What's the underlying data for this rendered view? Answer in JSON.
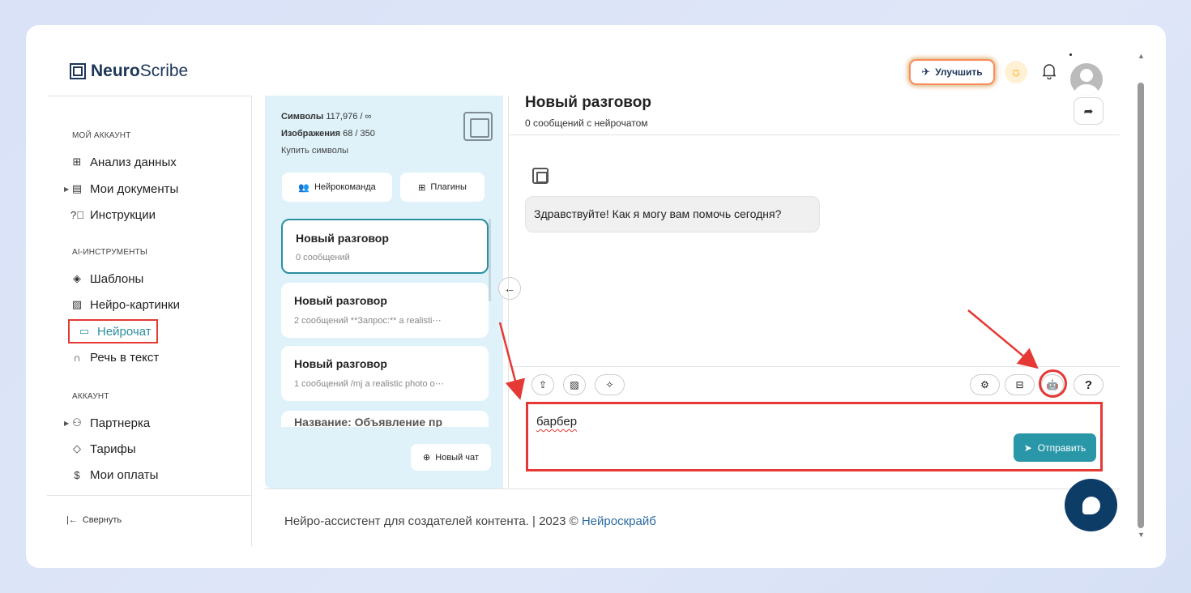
{
  "app": {
    "brand_bold": "Neuro",
    "brand_light": "Scribe"
  },
  "header": {
    "upgrade_label": "Улучшить"
  },
  "sidebar": {
    "sections": [
      {
        "title": "МОЙ АККАУНТ"
      },
      {
        "title": "AI-ИНСТРУМЕНТЫ"
      },
      {
        "title": "АККАУНТ"
      }
    ],
    "items": [
      {
        "label": "Анализ данных",
        "icon": "grid-icon"
      },
      {
        "label": "Мои документы",
        "icon": "document-icon"
      },
      {
        "label": "Инструкции",
        "icon": "help-circle-icon"
      },
      {
        "label": "Шаблоны",
        "icon": "layers-icon"
      },
      {
        "label": "Нейро-картинки",
        "icon": "image-icon"
      },
      {
        "label": "Нейрочат",
        "icon": "chat-icon",
        "active": true
      },
      {
        "label": "Речь в текст",
        "icon": "headphones-icon"
      },
      {
        "label": "Партнерка",
        "icon": "users-icon"
      },
      {
        "label": "Тарифы",
        "icon": "tag-icon"
      },
      {
        "label": "Мои оплаты",
        "icon": "dollar-icon"
      }
    ],
    "collapse_label": "Свернуть"
  },
  "chats_panel": {
    "symbols_label": "Символы",
    "symbols_value": "117,976 / ∞",
    "images_label": "Изображения",
    "images_value": "68 / 350",
    "buy_label": "Купить символы",
    "team_button": "Нейрокоманда",
    "plugins_button": "Плагины",
    "chats": [
      {
        "title": "Новый разговор",
        "meta": "0 сообщений"
      },
      {
        "title": "Новый разговор",
        "meta": "2 сообщений    **Запрос:** a realisti⋯"
      },
      {
        "title": "Новый разговор",
        "meta": "1 сообщений    /mj a realistic photo o⋯"
      },
      {
        "title": "Название: Объявление пр"
      }
    ],
    "new_chat_button": "Новый чат"
  },
  "chat": {
    "title": "Новый разговор",
    "subtitle": "0 сообщений с нейрочатом",
    "greeting": "Здравствуйте! Как я могу вам помочь сегодня?",
    "input_value": "барбер",
    "send_label": "Отправить",
    "help_label": "?"
  },
  "footer": {
    "text": "Нейро-ассистент для создателей контента.  | 2023 © ",
    "link": "Нейроскрайб"
  },
  "colors": {
    "accent": "#2a97a8",
    "annotation": "#e53935",
    "panel_bg": "#dff2fa",
    "fab": "#0d3d66"
  }
}
